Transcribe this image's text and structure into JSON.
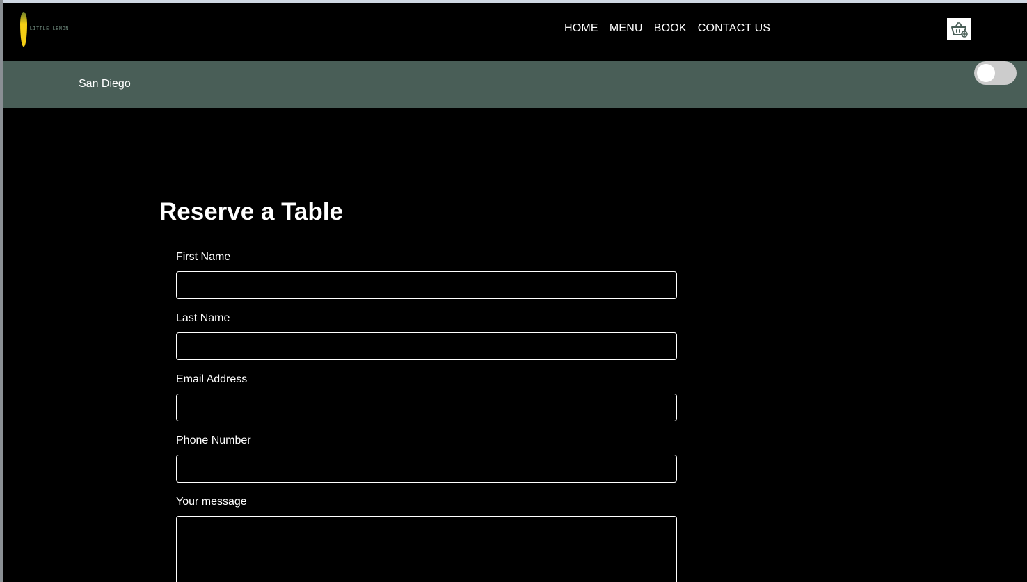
{
  "brand": {
    "logo_text": "LITTLE LEMON",
    "lemon_color": "#f4ce14",
    "green_color": "#495e57"
  },
  "nav": {
    "items": [
      {
        "label": "HOME"
      },
      {
        "label": "MENU"
      },
      {
        "label": "BOOK"
      },
      {
        "label": "CONTACT US"
      }
    ]
  },
  "header": {
    "basket_icon": "basket-add-icon"
  },
  "location_bar": {
    "location": "San Diego",
    "theme_toggle_on": false
  },
  "form": {
    "title": "Reserve a Table",
    "fields": {
      "first_name": {
        "label": "First Name",
        "value": ""
      },
      "last_name": {
        "label": "Last Name",
        "value": ""
      },
      "email": {
        "label": "Email Address",
        "value": ""
      },
      "phone": {
        "label": "Phone Number",
        "value": ""
      },
      "message": {
        "label": "Your message",
        "value": ""
      }
    }
  }
}
